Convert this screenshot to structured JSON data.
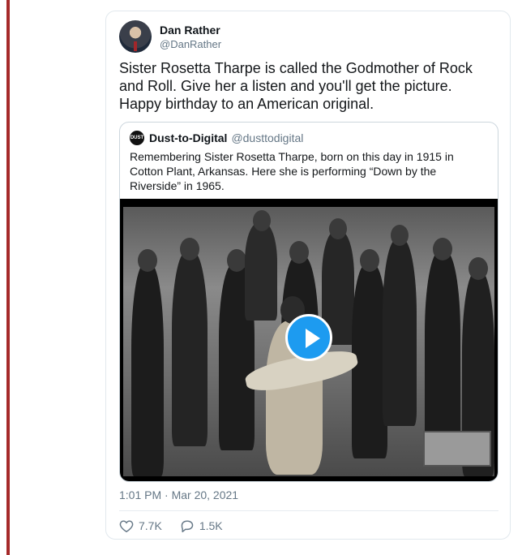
{
  "tweet": {
    "author": {
      "name": "Dan Rather",
      "handle": "@DanRather"
    },
    "text": "Sister Rosetta Tharpe is called the Godmother of Rock and Roll. Give her a listen and you'll get the picture. Happy birthday to an American original.",
    "quoted": {
      "name": "Dust-to-Digital",
      "handle": "@dusttodigital",
      "text": "Remembering Sister Rosetta Tharpe, born on this day in 1915 in Cotton Plant, Arkansas. Here she is performing “Down by the Riverside” in 1965.",
      "avatar_text": "DUST DIG"
    },
    "timestamp": "1:01 PM · Mar 20, 2021",
    "actions": {
      "likes": "7.7K",
      "replies": "1.5K"
    }
  },
  "colors": {
    "accent": "#1d9bf0",
    "left_rule": "#a52a2a",
    "muted": "#657786"
  },
  "icons": {
    "like": "heart-icon",
    "reply": "speech-bubble-icon",
    "play": "play-icon"
  }
}
